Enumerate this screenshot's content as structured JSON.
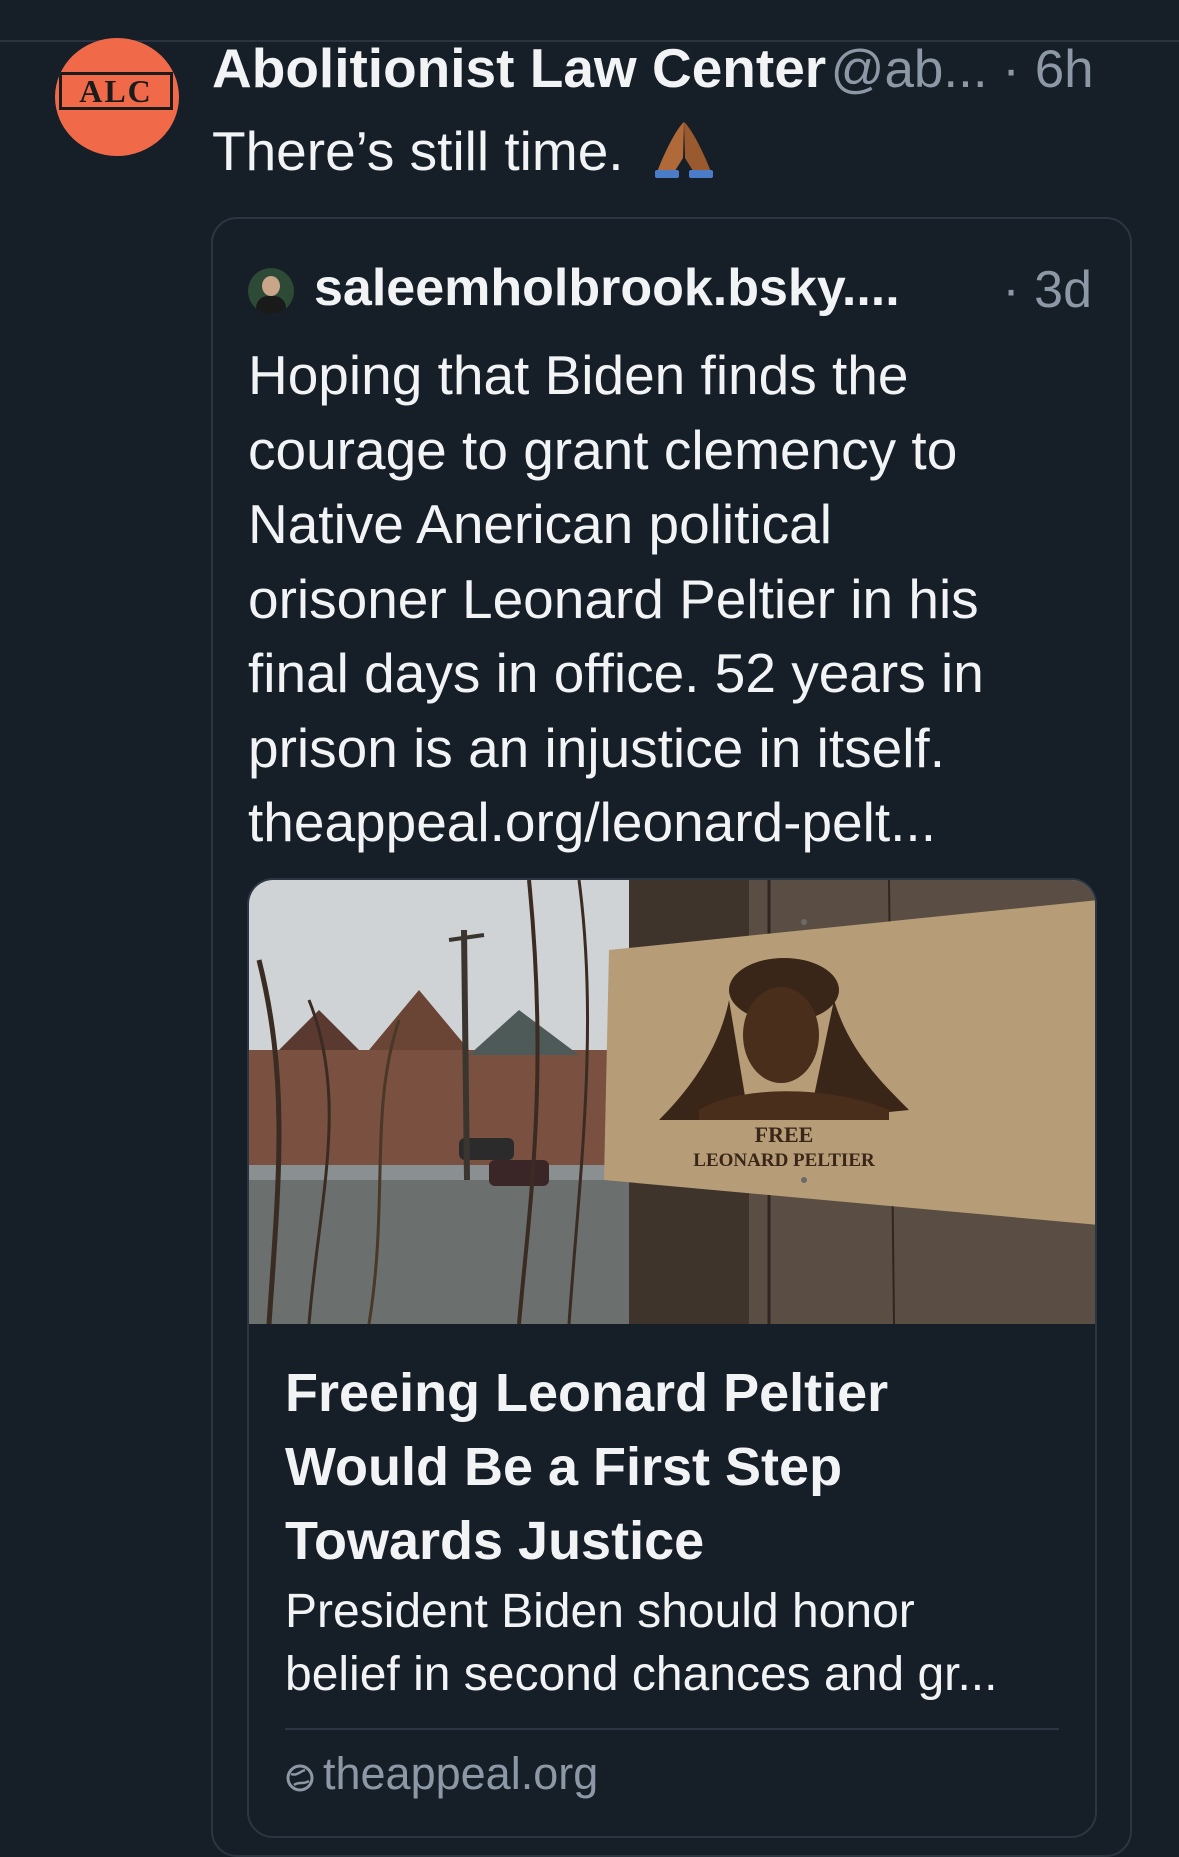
{
  "post": {
    "author_name": "Abolitionist Law Center",
    "author_handle": "@ab...",
    "separator": " · ",
    "time": "6h",
    "avatar_logo_text": "ALC",
    "text": "There’s still time.",
    "emoji": "folded-hands"
  },
  "quoted_post": {
    "author_handle": "saleemholbrook.bsky....",
    "time": "· 3d",
    "lines": [
      "Hoping that Biden finds the",
      "courage to grant clemency to",
      "Native Anerican political",
      "orisoner Leonard Peltier in his",
      "final days in office. 52 years in",
      "prison is an injustice in itself.",
      "theappeal.org/leonard-pelt..."
    ]
  },
  "link_card": {
    "image_sign_text": [
      "FREE",
      "LEONARD PELTIER"
    ],
    "title_lines": [
      "Freeing Leonard Peltier",
      "Would Be a First Step",
      "Towards Justice"
    ],
    "description_lines": [
      "President Biden should honor",
      "belief in second chances and gr..."
    ],
    "domain": "theappeal.org"
  },
  "colors": {
    "background": "#161e27",
    "text_primary": "#f1f3f5",
    "text_muted": "#8c98a5",
    "border": "#2c3643",
    "avatar_bg": "#f06a4a"
  }
}
